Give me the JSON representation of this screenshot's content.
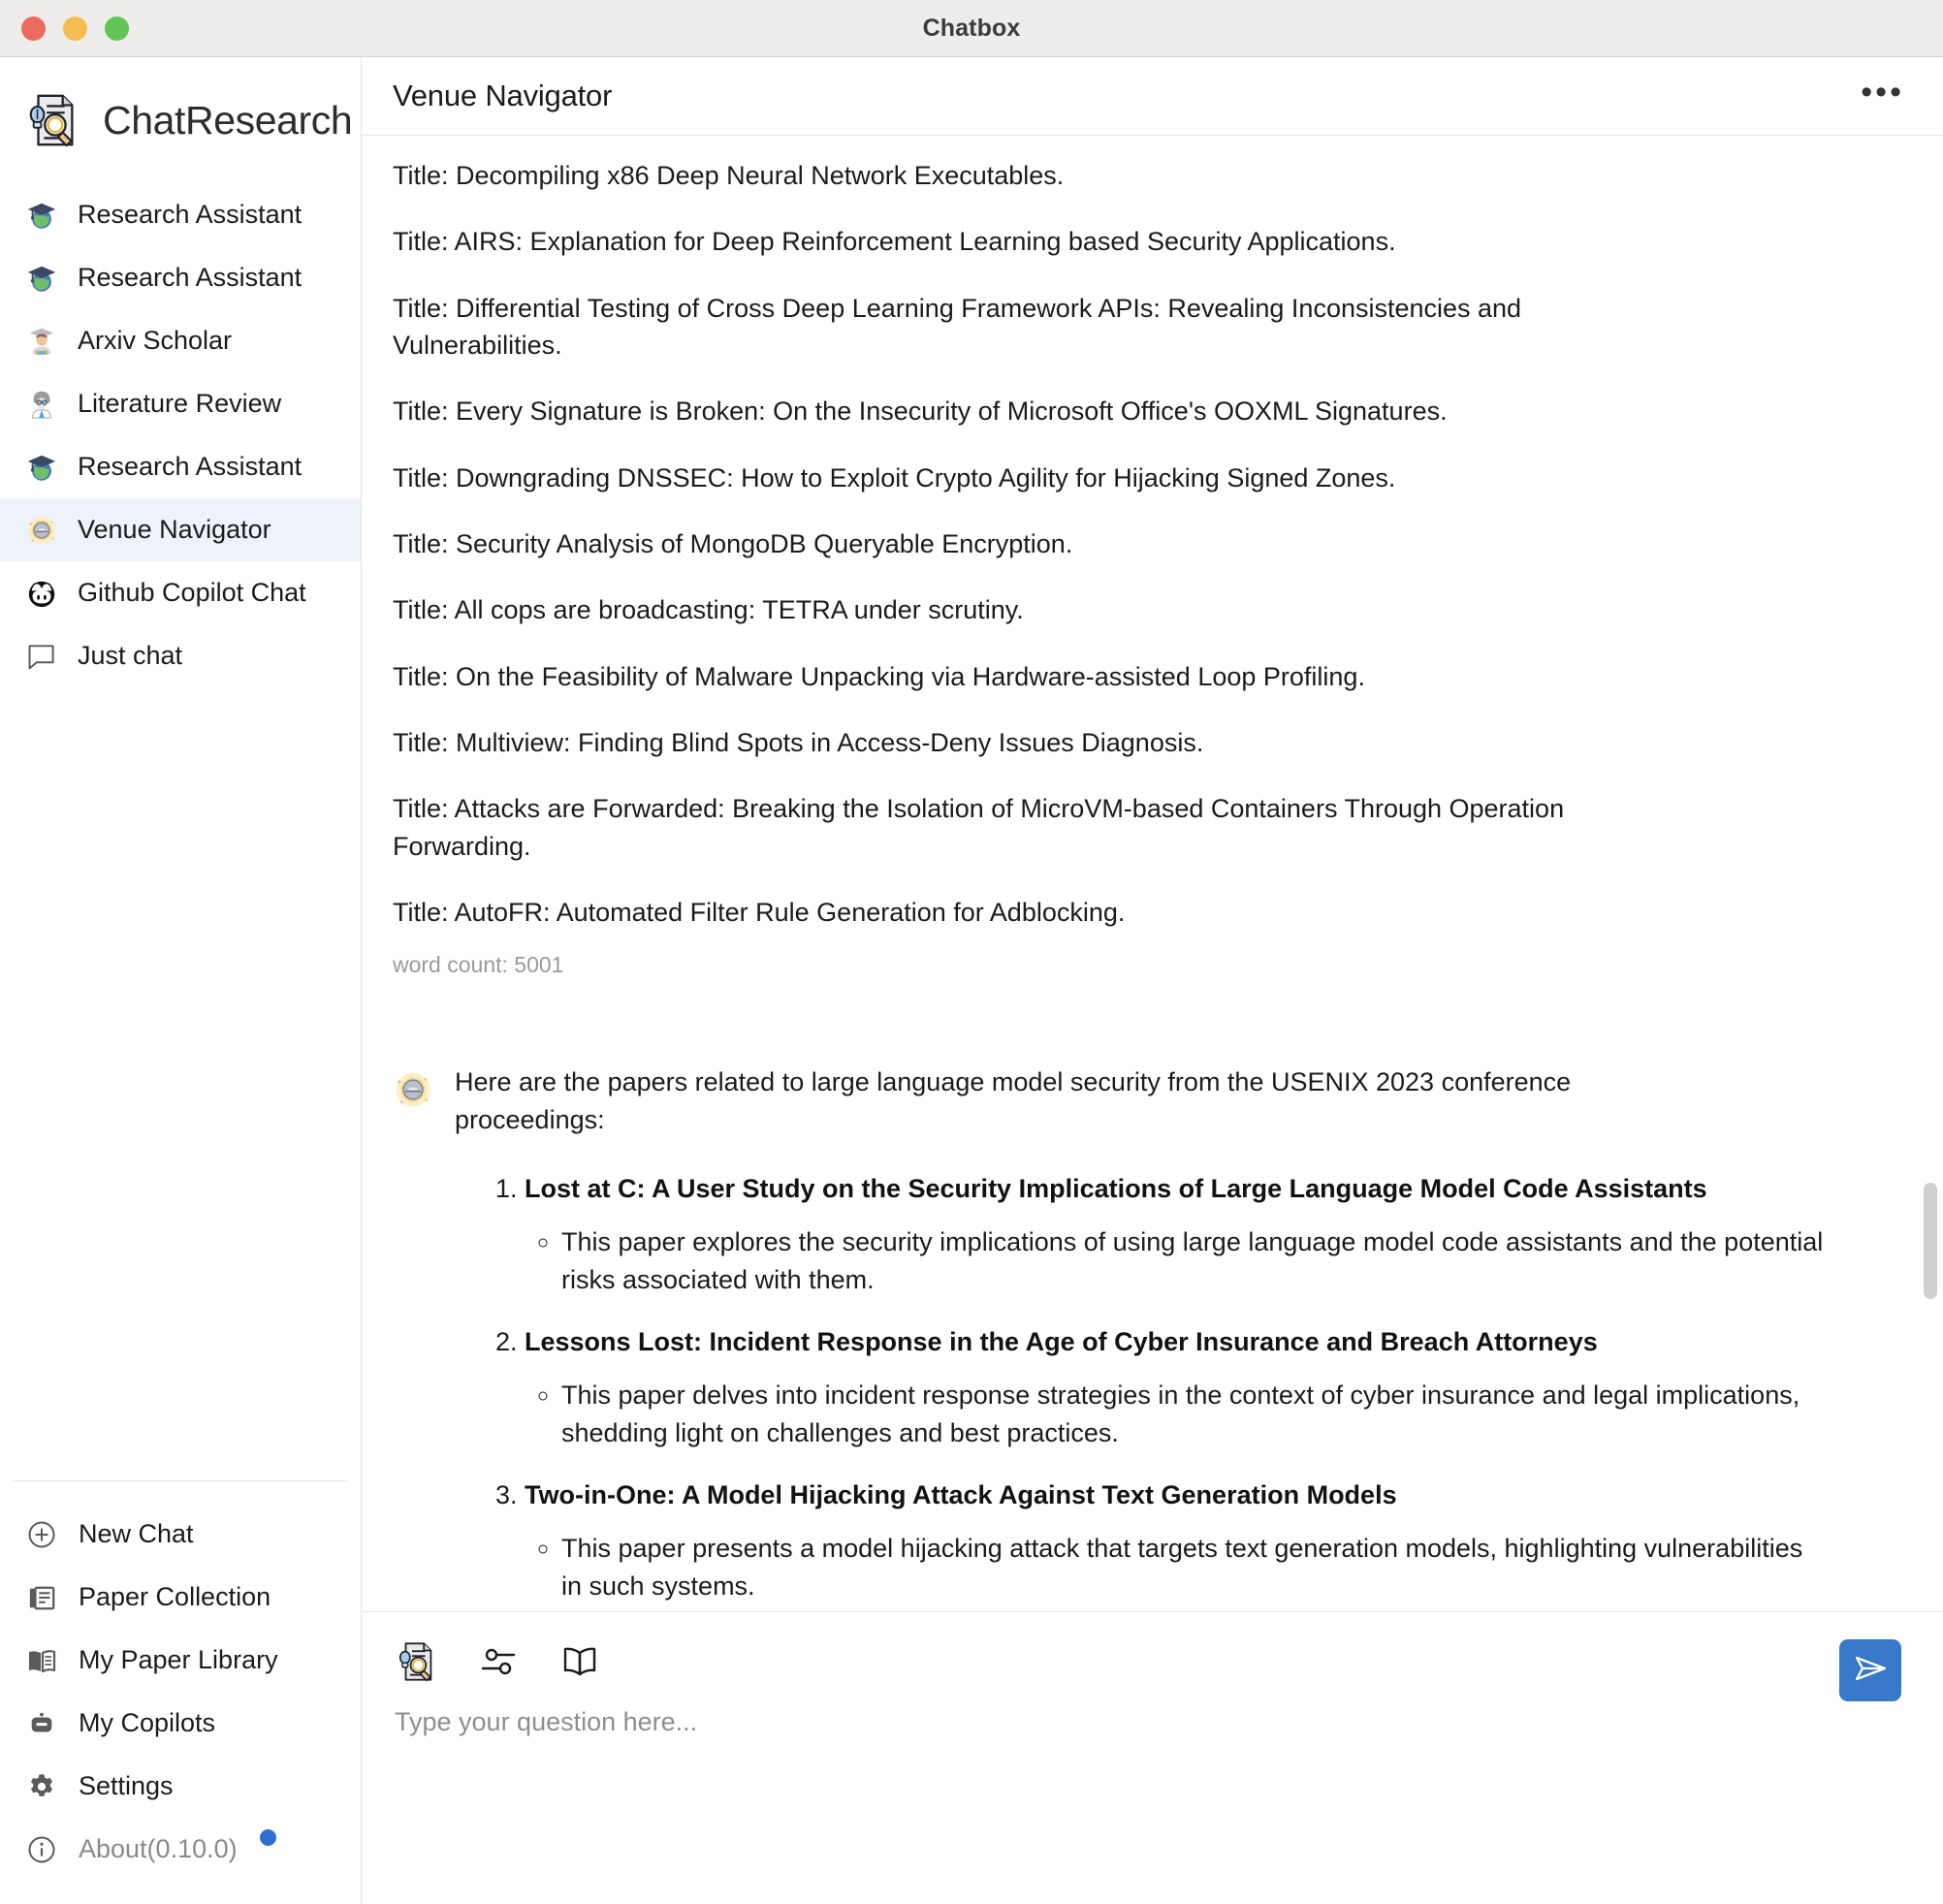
{
  "window": {
    "title": "Chatbox",
    "traffic_lights": [
      "close",
      "minimize",
      "maximize"
    ]
  },
  "sidebar": {
    "brand": {
      "name": "ChatResearch",
      "icon": "research-paper-magnifier-icon"
    },
    "chats": [
      {
        "label": "Research Assistant",
        "icon": "graduation-globe-icon",
        "selected": false
      },
      {
        "label": "Research Assistant",
        "icon": "graduation-globe-icon",
        "selected": false
      },
      {
        "label": "Arxiv Scholar",
        "icon": "scholar-person-icon",
        "selected": false
      },
      {
        "label": "Literature Review",
        "icon": "scientist-person-icon",
        "selected": false
      },
      {
        "label": "Research Assistant",
        "icon": "graduation-globe-icon",
        "selected": false
      },
      {
        "label": "Venue Navigator",
        "icon": "compass-glow-icon",
        "selected": true
      },
      {
        "label": "Github Copilot Chat",
        "icon": "copilot-icon",
        "selected": false
      },
      {
        "label": "Just chat",
        "icon": "speech-bubble-icon",
        "selected": false
      }
    ],
    "menu": [
      {
        "label": "New Chat",
        "icon": "plus-circle-icon",
        "muted": false,
        "badge": false
      },
      {
        "label": "Paper Collection",
        "icon": "paper-collection-icon",
        "muted": false,
        "badge": false
      },
      {
        "label": "My Paper Library",
        "icon": "open-book-icon",
        "muted": false,
        "badge": false
      },
      {
        "label": "My Copilots",
        "icon": "robot-icon",
        "muted": false,
        "badge": false
      },
      {
        "label": "Settings",
        "icon": "gear-icon",
        "muted": false,
        "badge": false
      },
      {
        "label": "About(0.10.0)",
        "icon": "info-circle-icon",
        "muted": true,
        "badge": true
      }
    ]
  },
  "header": {
    "title": "Venue Navigator",
    "more_label": "•••",
    "more_icon": "ellipsis-icon"
  },
  "conversation": {
    "titles": [
      "Title: Decompiling x86 Deep Neural Network Executables.",
      "Title: AIRS: Explanation for Deep Reinforcement Learning based Security Applications.",
      "Title: Differential Testing of Cross Deep Learning Framework APIs: Revealing Inconsistencies and Vulnerabilities.",
      "Title: Every Signature is Broken: On the Insecurity of Microsoft Office's OOXML Signatures.",
      "Title: Downgrading DNSSEC: How to Exploit Crypto Agility for Hijacking Signed Zones.",
      "Title: Security Analysis of MongoDB Queryable Encryption.",
      "Title: All cops are broadcasting: TETRA under scrutiny.",
      "Title: On the Feasibility of Malware Unpacking via Hardware-assisted Loop Profiling.",
      "Title: Multiview: Finding Blind Spots in Access-Deny Issues Diagnosis.",
      "Title: Attacks are Forwarded: Breaking the Isolation of MicroVM-based Containers Through Operation Forwarding.",
      "Title: AutoFR: Automated Filter Rule Generation for Adblocking."
    ],
    "word_count": "word count: 5001",
    "assistant": {
      "avatar_icon": "compass-glow-icon",
      "intro": "Here are the papers related to large language model security from the USENIX 2023 conference proceedings:",
      "papers": [
        {
          "title": "Lost at C: A User Study on the Security Implications of Large Language Model Code Assistants",
          "description": "This paper explores the security implications of using large language model code assistants and the potential risks associated with them."
        },
        {
          "title": "Lessons Lost: Incident Response in the Age of Cyber Insurance and Breach Attorneys",
          "description": "This paper delves into incident response strategies in the context of cyber insurance and legal implications, shedding light on challenges and best practices."
        },
        {
          "title": "Two-in-One: A Model Hijacking Attack Against Text Generation Models",
          "description": "This paper presents a model hijacking attack that targets text generation models, highlighting vulnerabilities in such systems."
        }
      ]
    }
  },
  "composer": {
    "tools": [
      {
        "icon": "research-paper-magnifier-icon",
        "name": "research-tool"
      },
      {
        "icon": "sliders-icon",
        "name": "settings-tool"
      },
      {
        "icon": "open-book-icon",
        "name": "library-tool"
      }
    ],
    "placeholder": "Type your question here...",
    "value": "",
    "send_icon": "send-paper-plane-icon"
  },
  "colors": {
    "accent": "#3878c8",
    "selected_item_bg": "#eef2fa",
    "badge": "#2f6fd0",
    "muted_text": "#8a8a8a"
  }
}
